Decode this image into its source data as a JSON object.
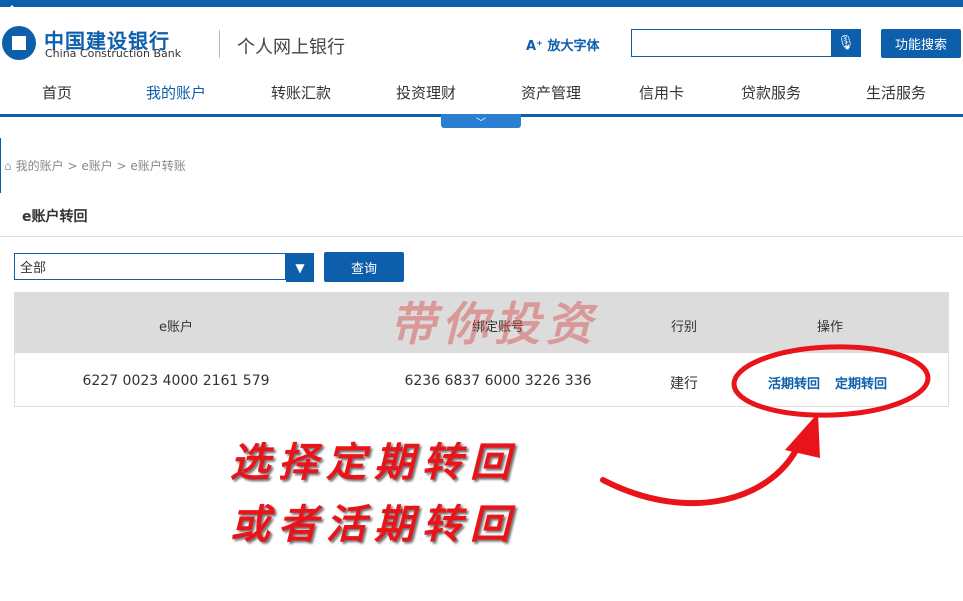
{
  "header": {
    "brand_cn": "中国建设银行",
    "brand_en": "China Construction Bank",
    "subtitle": "个人网上银行",
    "font_size_label": "放大字体",
    "search_placeholder": "",
    "search_button": "功能搜索"
  },
  "nav": {
    "items": [
      {
        "label": "首页"
      },
      {
        "label": "我的账户"
      },
      {
        "label": "转账汇款"
      },
      {
        "label": "投资理财"
      },
      {
        "label": "资产管理"
      },
      {
        "label": "信用卡"
      },
      {
        "label": "贷款服务"
      },
      {
        "label": "生活服务"
      }
    ],
    "active": "我的账户"
  },
  "breadcrumb": {
    "items": [
      "我的账户",
      "e账户",
      "e账户转账"
    ]
  },
  "section": {
    "title": "e账户转回"
  },
  "filter": {
    "selected": "全部",
    "query_button": "查询"
  },
  "table": {
    "headers": [
      "e账户",
      "绑定账号",
      "行别",
      "操作"
    ],
    "rows": [
      {
        "e_account": "6227 0023 4000 2161 579",
        "bound_account": "6236 6837 6000 3226 336",
        "bank": "建行",
        "actions": [
          "活期转回",
          "定期转回"
        ]
      }
    ]
  },
  "overlay": {
    "watermark": "带你投资",
    "annotation_line1": "选择定期转回",
    "annotation_line2": "或者活期转回"
  },
  "colors": {
    "brand": "#0d5eab",
    "annotation": "#e8141a",
    "header_row": "#dcdcdc"
  }
}
